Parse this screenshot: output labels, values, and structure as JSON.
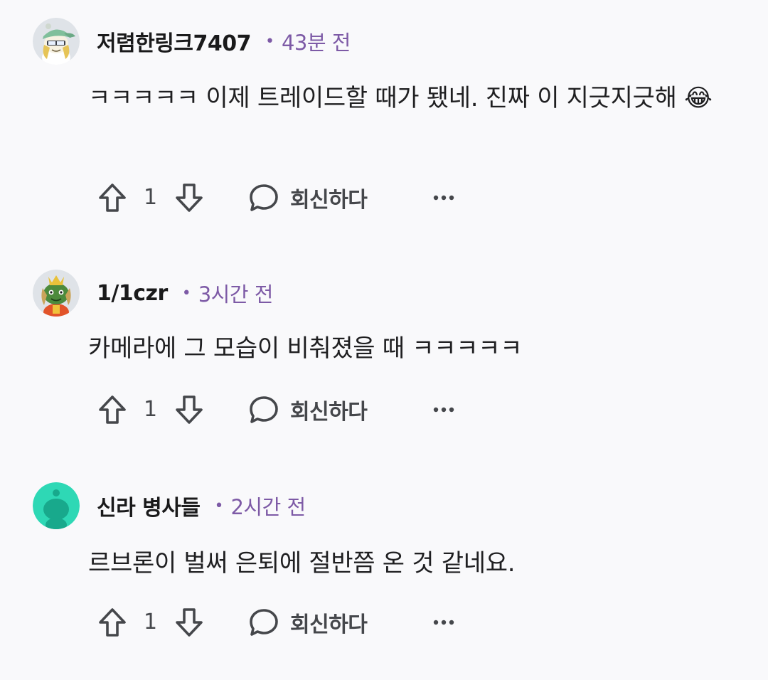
{
  "comments": [
    {
      "author": "저렴한링크7407",
      "time": "43분 전",
      "body": "ㅋㅋㅋㅋㅋ 이제 트레이드할 때가 됐네. 진짜 이 지긋지긋해 😂",
      "votes": "1",
      "reply_label": "회신하다",
      "avatar_icon": "avatar-snoo-cap-icon"
    },
    {
      "author": "1/1czr",
      "time": "3시간 전",
      "body": "카메라에 그 모습이 비춰졌을 때 ㅋㅋㅋㅋㅋ",
      "votes": "1",
      "reply_label": "회신하다",
      "avatar_icon": "avatar-snoo-crown-icon"
    },
    {
      "author": "신라 병사들",
      "time": "2시간 전",
      "body": "르브론이 벌써 은퇴에 절반쯤 온 것 같네요.",
      "votes": "1",
      "reply_label": "회신하다",
      "avatar_icon": "avatar-default-snoo-icon"
    }
  ],
  "meta_separator": "•",
  "colors": {
    "background": "#f9f9fb",
    "timestamp": "#7d5aa6",
    "action_gray": "#45474b",
    "default_avatar": "#2ed8b5"
  },
  "icons": {
    "upvote": "upvote-arrow-icon",
    "downvote": "downvote-arrow-icon",
    "reply": "speech-bubble-icon",
    "more": "more-dots-icon"
  }
}
